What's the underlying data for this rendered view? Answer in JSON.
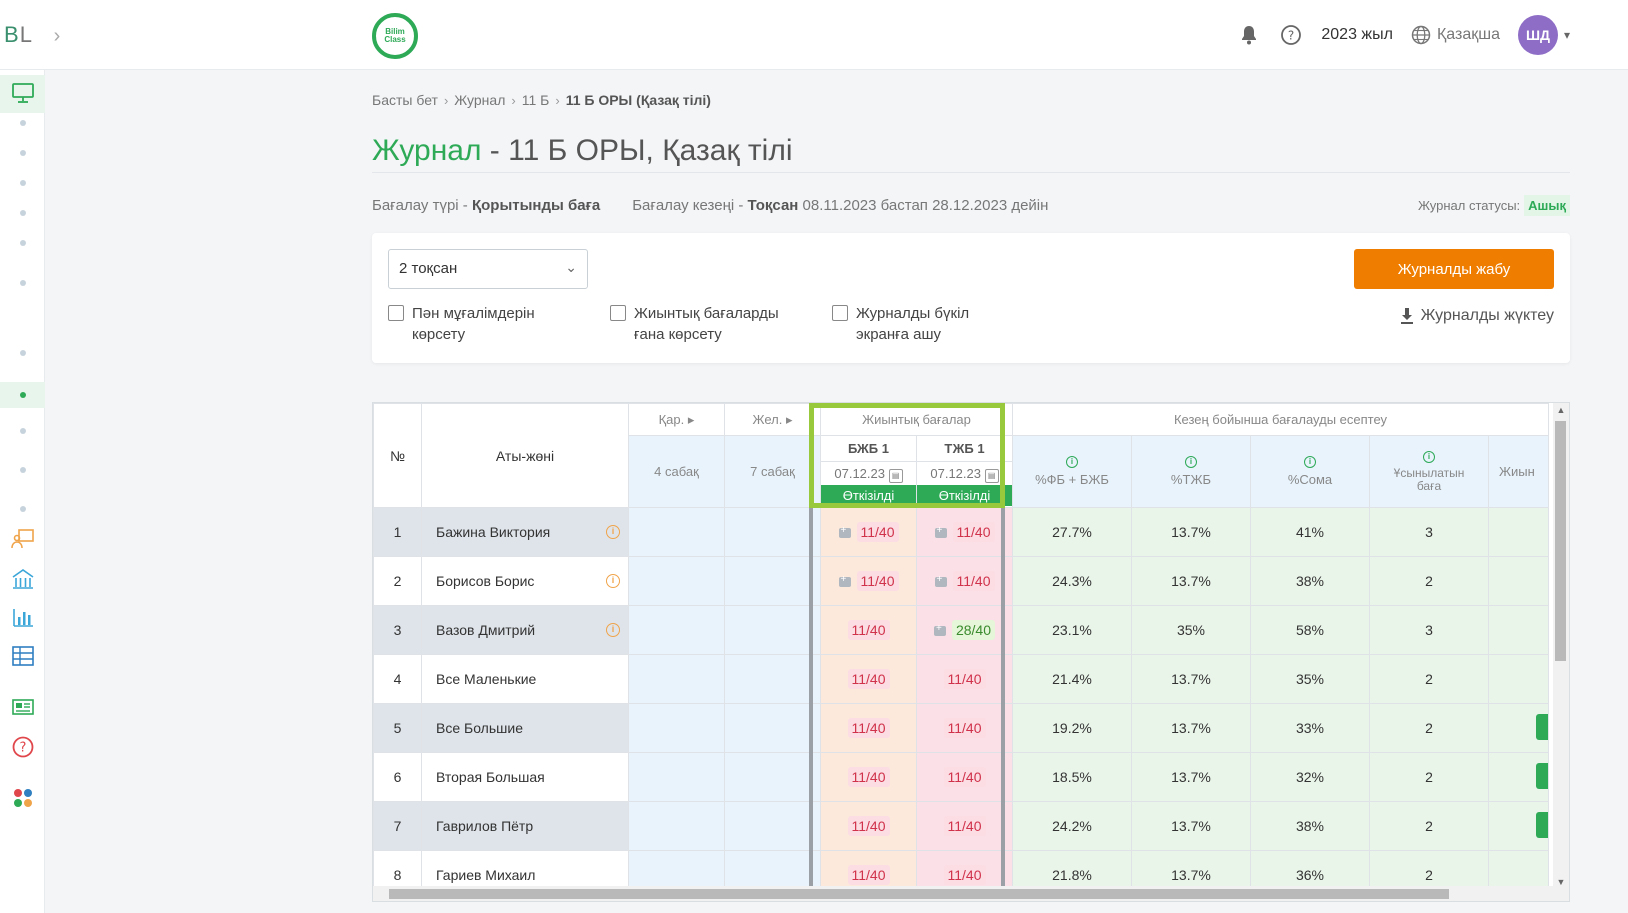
{
  "topbar": {
    "logo_b": "B",
    "logo_l": "L",
    "brand_text": "Bilim Class",
    "year": "2023 жыл",
    "language": "Қазақша",
    "avatar_initials": "ШД"
  },
  "breadcrumb": [
    "Басты бет",
    "Журнал",
    "11 Б",
    "11 Б ОРЫ (Қазақ тілі)"
  ],
  "title": {
    "green": "Журнал",
    "rest": " - 11 Б ОРЫ, Қазақ тілі"
  },
  "meta": {
    "type_label": "Бағалау түрі -",
    "type_value": "Қорытынды баға",
    "period_label": "Бағалау кезеңі -",
    "period_value": "Тоқсан",
    "period_range": "08.11.2023 бастап 28.12.2023 дейін",
    "status_label": "Журнал статусы:",
    "status_value": "Ашық"
  },
  "filters": {
    "quarter": "2 тоқсан",
    "show_teachers_line1": "Пән мұғалімдерін",
    "show_teachers_line2": "көрсету",
    "only_summative_line1": "Жиынтық бағаларды",
    "only_summative_line2": "ғана көрсету",
    "fullscreen_line1": "Журналды бүкіл",
    "fullscreen_line2": "экранға ашу",
    "close_button": "Журналды жабу",
    "download": "Журналды жүктеу"
  },
  "table": {
    "headers": {
      "num": "№",
      "name": "Аты-жөні",
      "kar": "Қар.",
      "zhel": "Жел.",
      "kar_sub": "4 сабақ",
      "zhel_sub": "7 сабақ",
      "summative": "Жиынтық бағалар",
      "period_calc": "Кезең бойынша бағалауды есептеу",
      "bzhb": "БЖБ 1",
      "tzhb": "ТЖБ 1",
      "bzhb_date": "07.12.23",
      "tzhb_date": "07.12.23",
      "conducted": "Өткізілді",
      "fb_bzhb": "%ФБ + БЖБ",
      "tzhb_pct": "%ТЖБ",
      "sum_pct": "%Сома",
      "recommended_line1": "Ұсынылатын",
      "recommended_line2": "баға",
      "last": "Жиын"
    },
    "rows": [
      {
        "num": "1",
        "name": "Бажина Виктория",
        "bzhb": "11/40",
        "tzhb": "11/40",
        "fb": "27.7%",
        "tzhb_pct": "13.7%",
        "sum": "41%",
        "rec": "3"
      },
      {
        "num": "2",
        "name": "Борисов Борис",
        "bzhb": "11/40",
        "tzhb": "11/40",
        "fb": "24.3%",
        "tzhb_pct": "13.7%",
        "sum": "38%",
        "rec": "2"
      },
      {
        "num": "3",
        "name": "Вазов Дмитрий",
        "bzhb": "11/40",
        "tzhb": "28/40",
        "fb": "23.1%",
        "tzhb_pct": "35%",
        "sum": "58%",
        "rec": "3"
      },
      {
        "num": "4",
        "name": "Все Маленькие",
        "bzhb": "11/40",
        "tzhb": "11/40",
        "fb": "21.4%",
        "tzhb_pct": "13.7%",
        "sum": "35%",
        "rec": "2"
      },
      {
        "num": "5",
        "name": "Все Большие",
        "bzhb": "11/40",
        "tzhb": "11/40",
        "fb": "19.2%",
        "tzhb_pct": "13.7%",
        "sum": "33%",
        "rec": "2"
      },
      {
        "num": "6",
        "name": "Вторая Большая",
        "bzhb": "11/40",
        "tzhb": "11/40",
        "fb": "18.5%",
        "tzhb_pct": "13.7%",
        "sum": "32%",
        "rec": "2"
      },
      {
        "num": "7",
        "name": "Гаврилов Пётр",
        "bzhb": "11/40",
        "tzhb": "11/40",
        "fb": "24.2%",
        "tzhb_pct": "13.7%",
        "sum": "38%",
        "rec": "2"
      },
      {
        "num": "8",
        "name": "Гариев Михаил",
        "bzhb": "11/40",
        "tzhb": "11/40",
        "fb": "21.8%",
        "tzhb_pct": "13.7%",
        "sum": "36%",
        "rec": "2"
      }
    ]
  },
  "colors": {
    "brand_green": "#2eaa57",
    "accent_orange": "#ef7d00",
    "highlight_border": "#98c93c",
    "grade_red": "#d0324b"
  }
}
